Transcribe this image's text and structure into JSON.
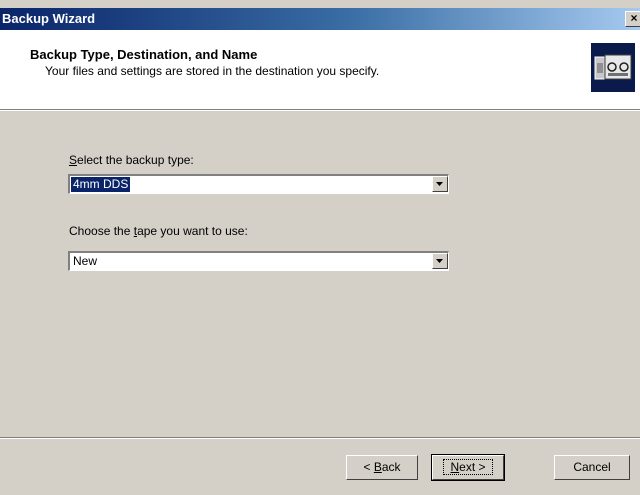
{
  "window": {
    "title": "Backup Wizard",
    "close_glyph": "×"
  },
  "header": {
    "title": "Backup Type, Destination, and Name",
    "subtitle": "Your files and settings are stored in the destination you specify.",
    "icon": "backup-tape-icon"
  },
  "fields": {
    "backup_type": {
      "label_mnemonic": "S",
      "label_rest": "elect the backup type:",
      "value": "4mm DDS"
    },
    "tape": {
      "label_before": "Choose the ",
      "label_mnemonic": "t",
      "label_rest": "ape you want to use:",
      "value": "New"
    }
  },
  "buttons": {
    "back_prefix": "< ",
    "back_mnemonic": "B",
    "back_rest": "ack",
    "next_mnemonic": "N",
    "next_rest": "ext >",
    "cancel": "Cancel"
  },
  "colors": {
    "titlebar_start": "#0a246a",
    "selection": "#0a246a",
    "dialog_face": "#d4d0c8"
  }
}
